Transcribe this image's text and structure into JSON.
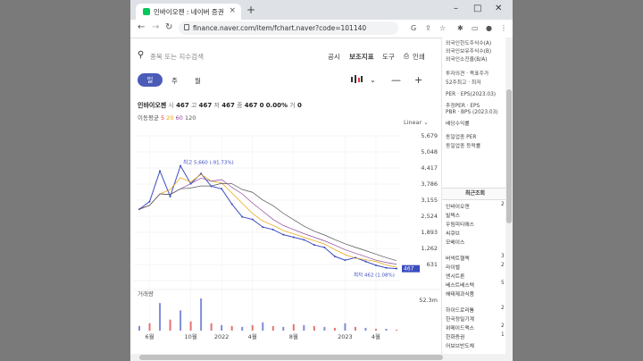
{
  "browser": {
    "tab_title": "인바이오젠 : 네이버 증권",
    "tab_close": "×",
    "new_tab": "+",
    "url": "finance.naver.com/item/fchart.naver?code=101140",
    "win_min": "–",
    "win_max": "□",
    "win_close": "✕"
  },
  "toolbar": {
    "search_placeholder": "종목 또는 지수검색",
    "announce": "공시",
    "indicator": "보조지표",
    "tools": "도구",
    "print": "인쇄"
  },
  "period": {
    "active": "일",
    "week": "주",
    "month": "월"
  },
  "quote": {
    "name": "인바이오젠",
    "open_label": "시",
    "open": "467",
    "high_label": "고",
    "high": "467",
    "low_label": "저",
    "low": "467",
    "close_label": "종",
    "close": "467",
    "change": "0",
    "change_pct": "0.00%",
    "vol_label": "거",
    "volume": "0"
  },
  "ma": {
    "label": "이동평균",
    "v1": "5",
    "v2": "20",
    "v3": "60",
    "v4": "120",
    "c1": "#e53935",
    "c2": "#e8a000",
    "c3": "#8e4a9e",
    "c4": "#555555"
  },
  "chart_data": {
    "type": "line",
    "scale": "Linear",
    "y_ticks": [
      "5,679",
      "5,048",
      "4,417",
      "3,786",
      "3,155",
      "2,524",
      "1,893",
      "1,262",
      "631"
    ],
    "x_ticks": [
      "6월",
      "10월",
      "2022",
      "4월",
      "8월",
      "2023",
      "4월"
    ],
    "high_label": "최고 5,660 (-91.73%)",
    "low_label": "최저 462 (1.08%)",
    "last_price": "467",
    "volume_label": "거래량",
    "volume_tick": "52.3m",
    "ylim": [
      0,
      5679
    ],
    "x": [
      "2021-05",
      "2021-06",
      "2021-07",
      "2021-08",
      "2021-09",
      "2021-10",
      "2021-11",
      "2021-12",
      "2022-01",
      "2022-02",
      "2022-03",
      "2022-04",
      "2022-05",
      "2022-06",
      "2022-07",
      "2022-08",
      "2022-09",
      "2022-10",
      "2022-11",
      "2022-12",
      "2023-01",
      "2023-02",
      "2023-03",
      "2023-04",
      "2023-05",
      "2023-06"
    ],
    "series": [
      {
        "values": [
          2800,
          3100,
          4300,
          3300,
          4500,
          3800,
          4200,
          3700,
          3600,
          3000,
          2500,
          2400,
          2100,
          2000,
          1800,
          1700,
          1600,
          1400,
          1300,
          950,
          800,
          900,
          750,
          600,
          500,
          467
        ]
      }
    ],
    "volume": [
      5,
      8,
      30,
      12,
      22,
      10,
      35,
      8,
      6,
      5,
      4,
      6,
      9,
      5,
      4,
      7,
      6,
      5,
      4,
      3,
      8,
      4,
      3,
      2,
      2,
      1
    ]
  },
  "right_panel": {
    "rows_top": [
      "외국인한도주식수(A)",
      "외국인보유주식수(B)",
      "외국인소진율(B/A)"
    ],
    "rows_mid": [
      "투자의견 · 목표주가",
      "52주최고 · 최저"
    ],
    "rows_per": [
      "PER · EPS(2023.03)",
      "추정PER · EPS",
      "PBR · BPS (2023.03)",
      "배당수익률"
    ],
    "rows_ind": [
      "동일업종 PER",
      "동일업종 등락률"
    ],
    "recent_title": "최근조회",
    "recent": [
      {
        "name": "인바이오젠",
        "n": "2"
      },
      {
        "name": "빌텍스",
        "n": ""
      },
      {
        "name": "우림피티에스",
        "n": ""
      },
      {
        "name": "씨큐브",
        "n": ""
      },
      {
        "name": "모베이스",
        "n": ""
      },
      {
        "name": "버넥트헬렉",
        "n": "3"
      },
      {
        "name": "라이벨",
        "n": "2"
      },
      {
        "name": "엔시트론",
        "n": ""
      },
      {
        "name": "베스트베스텍",
        "n": "5"
      },
      {
        "name": "해태제과식품",
        "n": ""
      },
      {
        "name": "하이드로리튬",
        "n": "2"
      },
      {
        "name": "한국정밀기계",
        "n": ""
      },
      {
        "name": "위메이드맥스",
        "n": "2"
      },
      {
        "name": "한화증권",
        "n": "1"
      },
      {
        "name": "어보브반도체",
        "n": ""
      }
    ]
  }
}
